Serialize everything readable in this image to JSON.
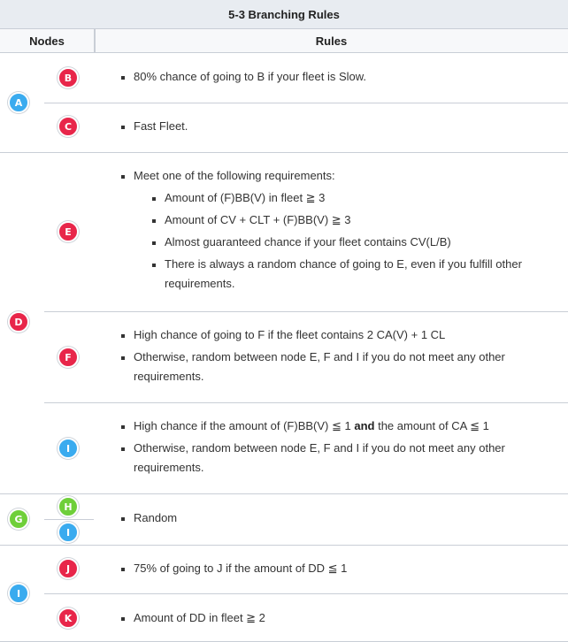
{
  "title": "5-3 Branching Rules",
  "headers": {
    "nodes": "Nodes",
    "rules": "Rules"
  },
  "nodes": {
    "A": "A",
    "B": "B",
    "C": "C",
    "D": "D",
    "E": "E",
    "F": "F",
    "I_d": "I",
    "G": "G",
    "H": "H",
    "I_g": "I",
    "I_src": "I",
    "J": "J",
    "K": "K"
  },
  "colors": {
    "red": "#e8264a",
    "blue": "#3aabef",
    "green": "#6fcf3a"
  },
  "rules": {
    "B": [
      "80% chance of going to B if your fleet is Slow."
    ],
    "C": [
      "Fast Fleet."
    ],
    "E": {
      "intro": "Meet one of the following requirements:",
      "sub": [
        "Amount of (F)BB(V) in fleet ≧ 3",
        "Amount of CV + CLT + (F)BB(V) ≧ 3",
        "Almost guaranteed chance if your fleet contains CV(L/B)",
        "There is always a random chance of going to E, even if you fulfill other requirements."
      ]
    },
    "F": [
      "High chance of going to F if the fleet contains 2 CA(V) + 1 CL",
      "Otherwise, random between node E, F and I if you do not meet any other requirements."
    ],
    "I_d": {
      "a": "High chance if the amount of (F)BB(V) ≦ 1 ",
      "and": "and",
      "b": " the amount of CA ≦ 1",
      "second": "Otherwise, random between node E, F and I if you do not meet any other requirements."
    },
    "GHI": [
      "Random"
    ],
    "J": [
      "75% of going to J if the amount of DD ≦ 1"
    ],
    "K": [
      "Amount of DD in fleet ≧ 2"
    ]
  }
}
